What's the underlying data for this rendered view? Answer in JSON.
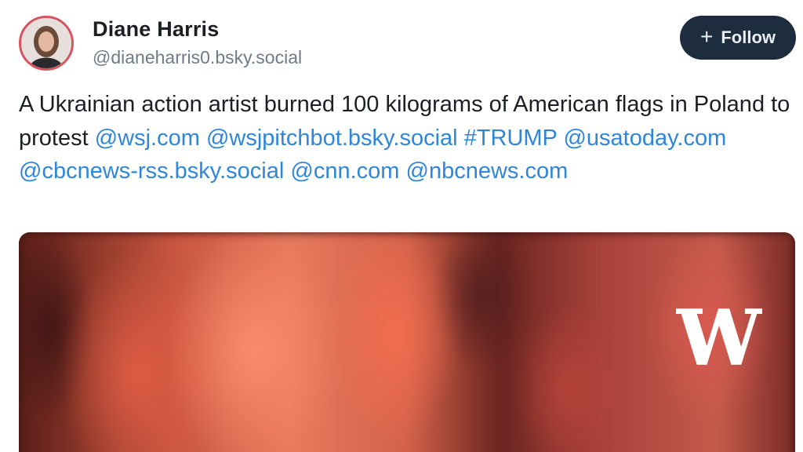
{
  "author": {
    "display_name": "Diane Harris",
    "handle": "@dianeharris0.bsky.social"
  },
  "follow_button": {
    "icon": "plus-icon",
    "icon_glyph": "+",
    "label": "Follow"
  },
  "post": {
    "text_intro": "A Ukrainian action artist burned 100 kilograms of American flags in Poland to protest ",
    "links": [
      "@wsj.com",
      "@wsjpitchbot.bsky.social",
      "#TRUMP",
      "@usatoday.com",
      "@cbcnews-rss.bsky.social",
      "@cnn.com",
      "@nbcnews.com"
    ]
  },
  "media": {
    "watermark_icon": "wsj-logo-icon",
    "watermark_letter": "W"
  },
  "colors": {
    "link": "#2f86d9",
    "follow_button_bg": "#1e2d3d",
    "avatar_ring": "#d9535f",
    "text": "#1b1f24",
    "muted": "#6f7b87"
  }
}
